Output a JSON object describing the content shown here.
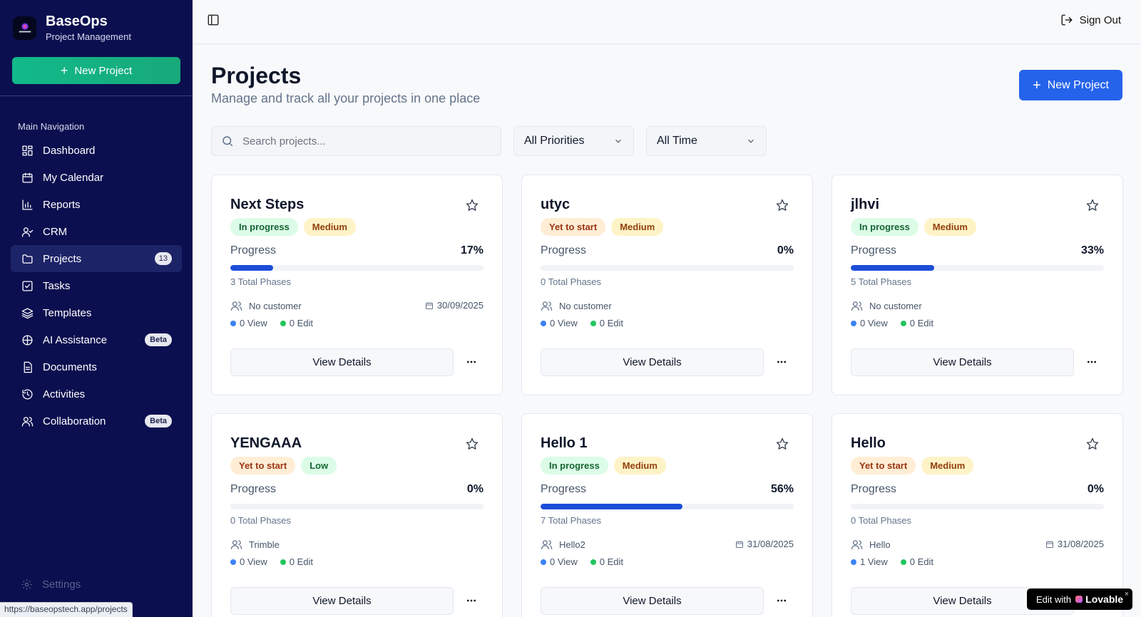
{
  "brand": {
    "name": "BaseOps",
    "subtitle": "Project Management",
    "logo_icon": "baseops-logo"
  },
  "sidebar": {
    "new_project_label": "New Project",
    "nav_heading": "Main Navigation",
    "items": [
      {
        "label": "Dashboard",
        "icon": "dashboard-icon"
      },
      {
        "label": "My Calendar",
        "icon": "calendar-icon"
      },
      {
        "label": "Reports",
        "icon": "bar-chart-icon"
      },
      {
        "label": "CRM",
        "icon": "user-check-icon"
      },
      {
        "label": "Projects",
        "icon": "folder-icon",
        "badge": "13",
        "active": true
      },
      {
        "label": "Tasks",
        "icon": "checkbox-icon"
      },
      {
        "label": "Templates",
        "icon": "layers-icon"
      },
      {
        "label": "AI Assistance",
        "icon": "ai-icon",
        "badge": "Beta"
      },
      {
        "label": "Documents",
        "icon": "document-icon"
      },
      {
        "label": "Activities",
        "icon": "history-icon"
      },
      {
        "label": "Collaboration",
        "icon": "users-icon",
        "badge": "Beta"
      }
    ],
    "settings_label": "Settings"
  },
  "topbar": {
    "sign_out_label": "Sign Out"
  },
  "main": {
    "title": "Projects",
    "subtitle": "Manage and track all your projects in one place",
    "new_project_label": "New Project",
    "search_placeholder": "Search projects...",
    "priority_filter": "All Priorities",
    "time_filter": "All Time"
  },
  "projects": [
    {
      "name": "Next Steps",
      "status": "In progress",
      "priority": "Medium",
      "progress_label": "Progress",
      "progress": "17%",
      "progress_value": 17,
      "phases": "3 Total Phases",
      "customer": "No customer",
      "date": "30/09/2025",
      "view": "0 View",
      "edit": "0 Edit",
      "button": "View Details"
    },
    {
      "name": "utyc",
      "status": "Yet to start",
      "priority": "Medium",
      "progress_label": "Progress",
      "progress": "0%",
      "progress_value": 0,
      "phases": "0 Total Phases",
      "customer": "No customer",
      "date": "",
      "view": "0 View",
      "edit": "0 Edit",
      "button": "View Details"
    },
    {
      "name": "jlhvi",
      "status": "In progress",
      "priority": "Medium",
      "progress_label": "Progress",
      "progress": "33%",
      "progress_value": 33,
      "phases": "5 Total Phases",
      "customer": "No customer",
      "date": "",
      "view": "0 View",
      "edit": "0 Edit",
      "button": "View Details"
    },
    {
      "name": "YENGAAA",
      "status": "Yet to start",
      "priority": "Low",
      "progress_label": "Progress",
      "progress": "0%",
      "progress_value": 0,
      "phases": "0 Total Phases",
      "customer": "Trimble",
      "date": "",
      "view": "0 View",
      "edit": "0 Edit",
      "button": "View Details"
    },
    {
      "name": "Hello 1",
      "status": "In progress",
      "priority": "Medium",
      "progress_label": "Progress",
      "progress": "56%",
      "progress_value": 56,
      "phases": "7 Total Phases",
      "customer": "Hello2",
      "date": "31/08/2025",
      "view": "0 View",
      "edit": "0 Edit",
      "button": "View Details"
    },
    {
      "name": "Hello",
      "status": "Yet to start",
      "priority": "Medium",
      "progress_label": "Progress",
      "progress": "0%",
      "progress_value": 0,
      "phases": "0 Total Phases",
      "customer": "Hello",
      "date": "31/08/2025",
      "view": "1 View",
      "edit": "0 Edit",
      "button": "View Details"
    }
  ],
  "status_bar": {
    "url": "https://baseopstech.app/projects"
  },
  "lovable": {
    "prefix": "Edit with",
    "brand": "Lovable",
    "close": "×"
  },
  "colors": {
    "sidebar_bg": "#0b0f4f",
    "primary": "#2563eb",
    "accent_green": "#12b98a"
  }
}
